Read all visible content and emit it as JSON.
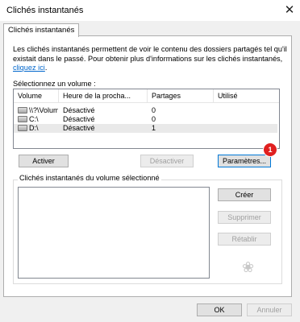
{
  "window": {
    "title": "Clichés instantanés",
    "close_glyph": "✕"
  },
  "tab": {
    "label": "Clichés instantanés"
  },
  "description": {
    "text": "Les clichés instantanés permettent de voir le contenu des dossiers partagés tel qu'il existait dans le passé. Pour obtenir plus d'informations sur les clichés instantanés,",
    "link": "cliquez ici",
    "suffix": "."
  },
  "volume_section": {
    "label": "Sélectionnez un volume :",
    "columns": [
      "Volume",
      "Heure de la procha...",
      "Partages",
      "Utilisé"
    ],
    "rows": [
      {
        "volume": "\\\\?\\Volume{...",
        "next": "Désactivé",
        "shares": "0",
        "used": "",
        "icon": "drive-icon",
        "selected": false
      },
      {
        "volume": "C:\\",
        "next": "Désactivé",
        "shares": "0",
        "used": "",
        "icon": "drive-icon",
        "selected": false
      },
      {
        "volume": "D:\\",
        "next": "Désactivé",
        "shares": "1",
        "used": "",
        "icon": "drive-icon",
        "selected": true
      }
    ]
  },
  "buttons": {
    "enable": "Activer",
    "disable": "Désactiver",
    "settings": "Paramètres...",
    "create": "Créer",
    "delete": "Supprimer",
    "restore": "Rétablir",
    "ok": "OK",
    "cancel": "Annuler"
  },
  "badge": {
    "value": "1",
    "color": "#e02020"
  },
  "snapshots_group": {
    "label": "Clichés instantanés du volume sélectionné"
  },
  "colors": {
    "accent": "#0078d7",
    "link": "#0066cc",
    "disabled_text": "#a0a0a0"
  }
}
